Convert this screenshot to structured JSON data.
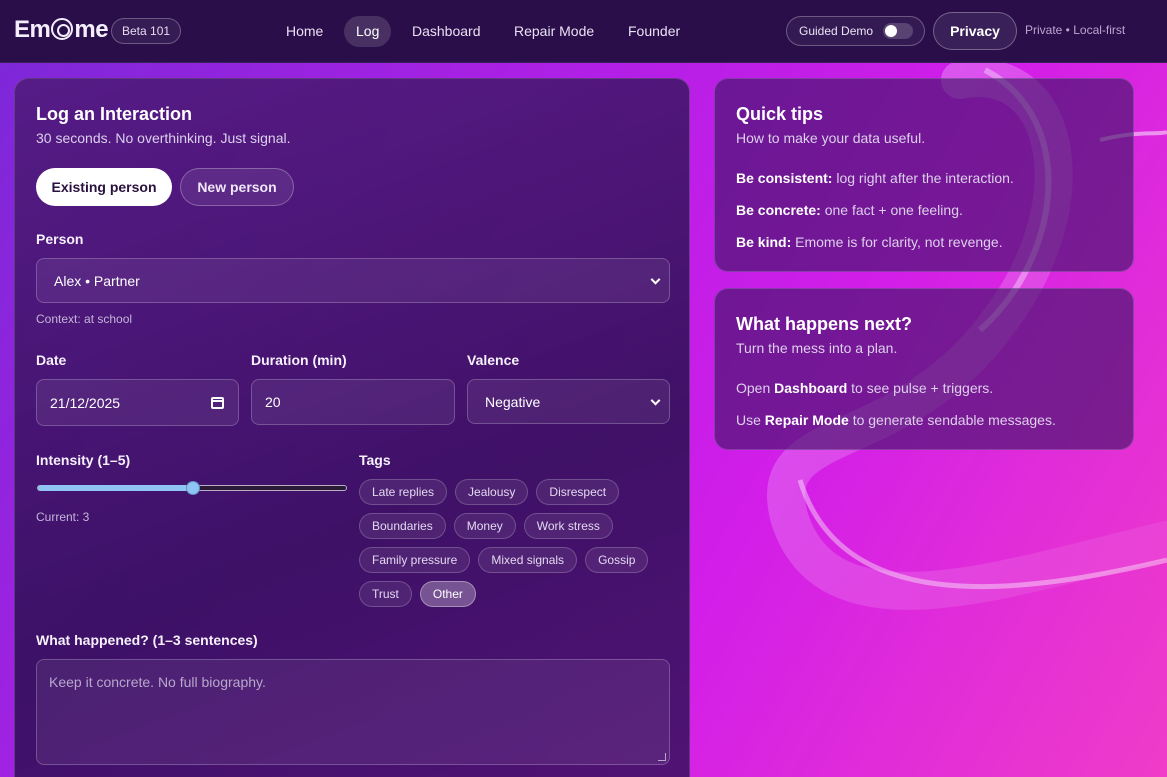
{
  "header": {
    "logo": "Emome",
    "beta": "Beta 101",
    "nav": [
      "Home",
      "Log",
      "Dashboard",
      "Repair Mode",
      "Founder"
    ],
    "active_nav": "Log",
    "guided_demo": "Guided Demo",
    "guided_demo_on": false,
    "privacy": "Privacy",
    "privacy_note": "Private • Local-first"
  },
  "log": {
    "title": "Log an Interaction",
    "subtitle": "30 seconds. No overthinking. Just signal.",
    "mode_existing": "Existing person",
    "mode_new": "New person",
    "person_label": "Person",
    "person_value": "Alex • Partner",
    "person_context": "Context: at school",
    "date_label": "Date",
    "date_value": "21/12/2025",
    "duration_label": "Duration (min)",
    "duration_value": "20",
    "valence_label": "Valence",
    "valence_value": "Negative",
    "intensity_label": "Intensity (1–5)",
    "intensity_value": 3,
    "intensity_min": 1,
    "intensity_max": 5,
    "intensity_current": "Current: 3",
    "tags_label": "Tags",
    "tags": [
      [
        "Late replies",
        "Jealousy",
        "Disrespect"
      ],
      [
        "Boundaries",
        "Money",
        "Work stress"
      ],
      [
        "Family pressure",
        "Mixed signals",
        "Gossip"
      ],
      [
        "Trust",
        "Other"
      ]
    ],
    "selected_tag": "Other",
    "what_label": "What happened? (1–3 sentences)",
    "what_placeholder": "Keep it concrete. No full biography."
  },
  "tips": {
    "title": "Quick tips",
    "subtitle": "How to make your data useful.",
    "items": [
      {
        "bold": "Be consistent:",
        "text": " log right after the interaction."
      },
      {
        "bold": "Be concrete:",
        "text": " one fact + one feeling."
      },
      {
        "bold": "Be kind:",
        "text": " Emome is for clarity, not revenge."
      }
    ]
  },
  "next": {
    "title": "What happens next?",
    "subtitle": "Turn the mess into a plan.",
    "line1_pre": "Open ",
    "line1_bold": "Dashboard",
    "line1_post": " to see pulse + triggers.",
    "line2_pre": "Use ",
    "line2_bold": "Repair Mode",
    "line2_post": " to generate sendable messages."
  }
}
